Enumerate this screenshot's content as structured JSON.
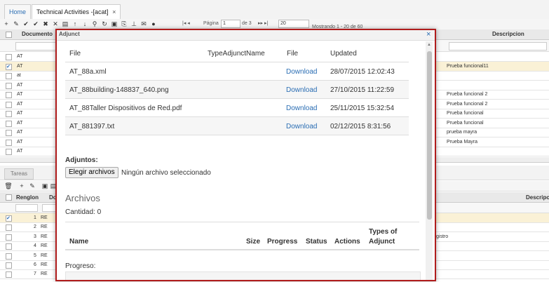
{
  "tabs": {
    "home": "Home",
    "active": "Technical Activities -[acat]",
    "close": "×"
  },
  "pager": {
    "page_label": "Página",
    "page_value": "1",
    "of": "de 3",
    "size": "20",
    "showing": "Mostrando 1 - 20 de 60"
  },
  "grid": {
    "col_documento": "Documento",
    "col_descripcion": "Descripcion",
    "rows": [
      {
        "doc": "AT",
        "desc": "",
        "selected": false
      },
      {
        "doc": "AT",
        "desc": "Prueba funcional11",
        "selected": true
      },
      {
        "doc": "at",
        "desc": "",
        "selected": false
      },
      {
        "doc": "AT",
        "desc": "",
        "selected": false
      },
      {
        "doc": "AT",
        "desc": "Prueba funcional 2",
        "selected": false
      },
      {
        "doc": "AT",
        "desc": "Prueba funcional 2",
        "selected": false
      },
      {
        "doc": "AT",
        "desc": "Prueba funcional",
        "selected": false
      },
      {
        "doc": "AT",
        "desc": "Prueba funcional",
        "selected": false
      },
      {
        "doc": "AT",
        "desc": "prueba mayra",
        "selected": false
      },
      {
        "doc": "AT",
        "desc": "Prueba Mayra",
        "selected": false
      },
      {
        "doc": "AT",
        "desc": "",
        "selected": false
      }
    ]
  },
  "tareas": {
    "tab": "Tareas",
    "col_renglon": "Renglon",
    "col_do": "Do",
    "col_descripcion": "Descripc",
    "rows": [
      {
        "n": "1",
        "re": "RE",
        "desc": "",
        "selected": true
      },
      {
        "n": "2",
        "re": "RE",
        "desc": "",
        "selected": false
      },
      {
        "n": "3",
        "re": "RE",
        "desc": "gistro",
        "selected": false
      },
      {
        "n": "4",
        "re": "RE",
        "desc": "",
        "selected": false
      },
      {
        "n": "5",
        "re": "RE",
        "desc": "",
        "selected": false
      },
      {
        "n": "6",
        "re": "RE",
        "desc": "",
        "selected": false
      },
      {
        "n": "7",
        "re": "RE",
        "desc": "",
        "selected": false
      }
    ]
  },
  "modal": {
    "title": "Adjunct",
    "close": "×",
    "headers": {
      "file": "File",
      "type": "TypeAdjunctName",
      "file2": "File",
      "updated": "Updated"
    },
    "files": [
      {
        "name": "AT_88a.xml",
        "link": "Download",
        "updated": "28/07/2015 12:02:43"
      },
      {
        "name": "AT_88building-148837_640.png",
        "link": "Download",
        "updated": "27/10/2015 11:22:59"
      },
      {
        "name": "AT_88Taller Dispositivos de Red.pdf",
        "link": "Download",
        "updated": "25/11/2015 15:32:54"
      },
      {
        "name": "AT_881397.txt",
        "link": "Download",
        "updated": "02/12/2015 8:31:56"
      }
    ],
    "adjuntos_label": "Adjuntos:",
    "choose_button": "Elegir archivos",
    "no_file": "Ningún archivo seleccionado",
    "archivos_title": "Archivos",
    "cantidad": "Cantidad: 0",
    "cols": {
      "name": "Name",
      "size": "Size",
      "progress": "Progress",
      "status": "Status",
      "actions": "Actions",
      "types1": "Types of",
      "types2": "Adjunct"
    },
    "progreso": "Progreso:"
  }
}
